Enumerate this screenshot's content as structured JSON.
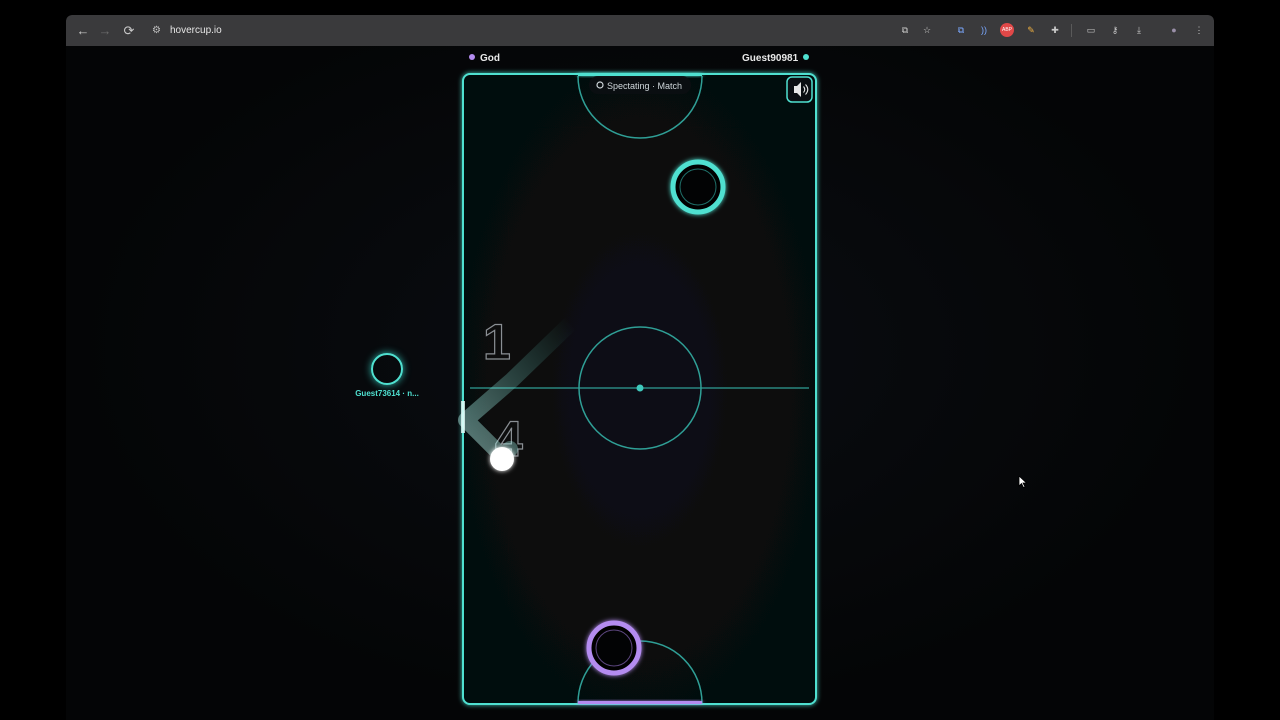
{
  "browser": {
    "url": "hovercup.io",
    "nav": {
      "back": "←",
      "forward": "→",
      "reload": "⟳",
      "site_icon": "⚙"
    },
    "extensions": [
      {
        "name": "install-app-icon",
        "glyph": "⧉",
        "color": "#c9c9c9"
      },
      {
        "name": "bookmark-star-icon",
        "glyph": "☆",
        "color": "#c9c9c9"
      },
      {
        "name": "translate-extension-icon",
        "glyph": "⧉",
        "color": "#7aa8ff"
      },
      {
        "name": "audio-extension-icon",
        "glyph": "))",
        "color": "#7aa8ff"
      },
      {
        "name": "abp-extension-icon",
        "glyph": "ABP",
        "color": "#e04848"
      },
      {
        "name": "pen-extension-icon",
        "glyph": "✎",
        "color": "#f0b040"
      },
      {
        "name": "puzzle-extension-icon",
        "glyph": "✚",
        "color": "#c9c9c9"
      },
      {
        "name": "cast-icon",
        "glyph": "▭",
        "color": "#c9c9c9"
      },
      {
        "name": "password-key-icon",
        "glyph": "⚷",
        "color": "#c9c9c9"
      },
      {
        "name": "download-icon",
        "glyph": "⤓",
        "color": "#c9c9c9"
      },
      {
        "name": "profile-avatar-icon",
        "glyph": "●",
        "color": "#9a8fa8"
      },
      {
        "name": "menu-kebab-icon",
        "glyph": "⋮",
        "color": "#c9c9c9"
      }
    ]
  },
  "match": {
    "player_left": {
      "name": "God",
      "color": "#b48cf0"
    },
    "player_right": {
      "name": "Guest90981",
      "color": "#4fe0d0"
    },
    "status_label": "Spectating · Match",
    "status_icon": "eye-icon",
    "sound_icon": "speaker-icon",
    "score_top": "1",
    "score_bottom": "4",
    "spectator": {
      "name": "Guest73614 · n..."
    }
  },
  "colors": {
    "rink": "#4fe0d0",
    "player_left": "#b48cf0",
    "player_right": "#4fe0d0"
  }
}
